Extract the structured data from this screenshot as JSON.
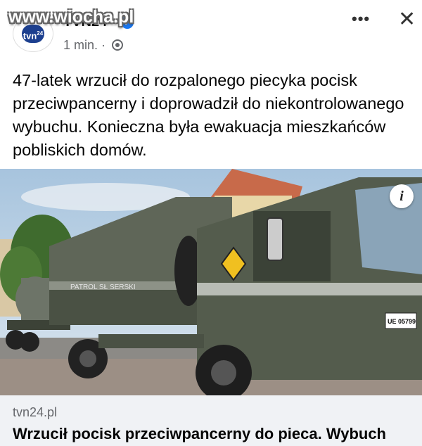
{
  "watermark": "www.wiocha.pl",
  "post": {
    "page_name": "TVN24",
    "avatar_text": "tvn",
    "avatar_sup": "24",
    "time": "1 min. ·",
    "text": "47-latek wrzucił do rozpalonego piecyka pocisk przeciwpancerny i doprowadził do niekontrolowanego wybuchu. Konieczna była ewakuacja mieszkańców pobliskich domów."
  },
  "icons": {
    "more": "•••",
    "close": "✕",
    "info": "i",
    "verified": "✓"
  },
  "photo": {
    "tarp_text": "PATROL SŁ SERSKI",
    "plate": "UE 05799"
  },
  "link": {
    "domain": "tvn24.pl",
    "title": "Wrzucił pocisk przeciwpancerny do pieca. Wybuch"
  }
}
